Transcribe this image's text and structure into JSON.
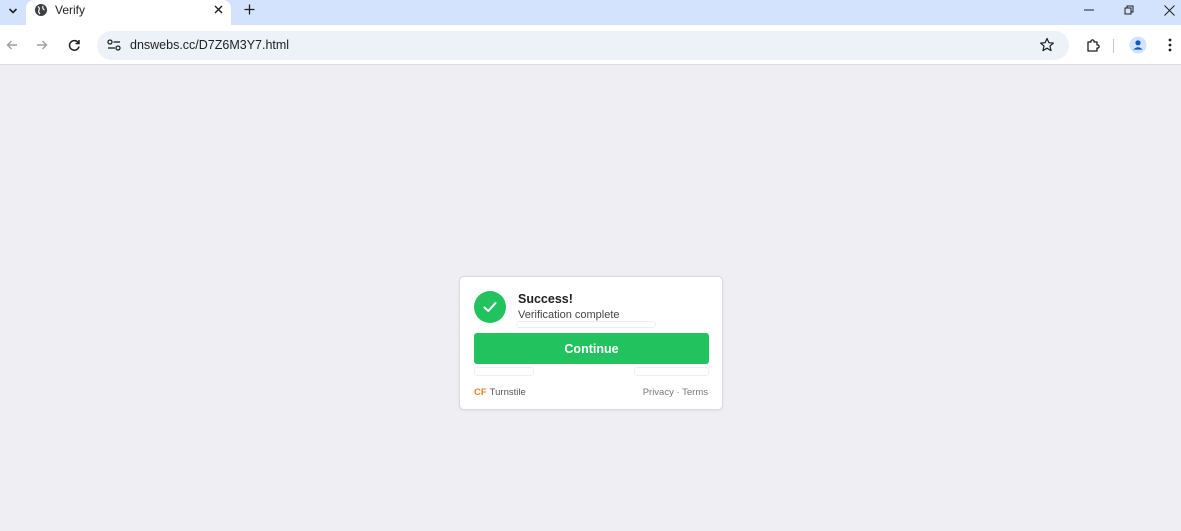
{
  "browser": {
    "tab": {
      "title": "Verify"
    },
    "address_bar": {
      "url": "dnswebs.cc/D7Z6M3Y7.html"
    }
  },
  "card": {
    "status_title": "Success!",
    "status_subtitle": "Verification complete",
    "continue_label": "Continue",
    "brand_mark": "CF",
    "brand_name": "Turnstile",
    "privacy_label": "Privacy",
    "separator": "·",
    "terms_label": "Terms"
  },
  "colors": {
    "success_green": "#22c35e",
    "cloudflare_orange": "#f38020",
    "page_background": "#efeff3",
    "tabstrip": "#d3e3fd"
  },
  "icons": [
    "chevron-down-icon",
    "globe-icon",
    "close-icon",
    "plus-icon",
    "minimize-icon",
    "restore-icon",
    "back-arrow-icon",
    "forward-arrow-icon",
    "reload-icon",
    "site-info-icon",
    "star-icon",
    "extensions-icon",
    "profile-icon",
    "more-vertical-icon",
    "checkmark-icon"
  ]
}
